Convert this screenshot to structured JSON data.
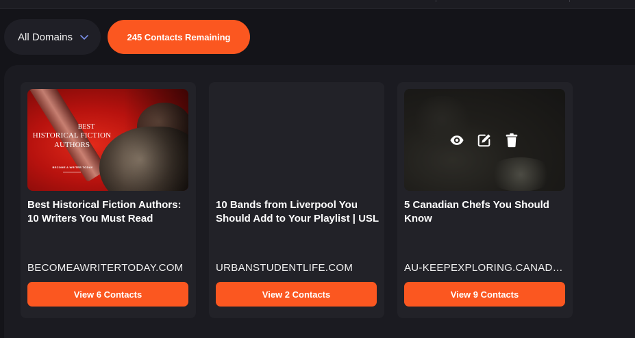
{
  "toolbar": {
    "domain_filter": "All Domains",
    "contacts_remaining": "245 Contacts Remaining"
  },
  "thumbnail_text": {
    "line1": "BEST",
    "line2": "HISTORICAL FICTION",
    "line3": "AUTHORS",
    "line4": "BECOME A WRITER TODAY"
  },
  "cards": [
    {
      "title": "Best Historical Fiction Authors: 10 Writers You Must Read",
      "domain": "BECOMEAWRITERTODAY.COM",
      "button": "View 6 Contacts",
      "thumbnail": "historical-fiction-image"
    },
    {
      "title": "10 Bands from Liverpool You Should Add to Your Playlist | USL",
      "domain": "URBANSTUDENTLIFE.COM",
      "button": "View 2 Contacts",
      "thumbnail": "none"
    },
    {
      "title": "5 Canadian Chefs You Should Know",
      "domain": "AU-KEEPEXPLORING.CANADA.TRAVEL",
      "button": "View 9 Contacts",
      "thumbnail": "food-image",
      "hover_actions": [
        "eye-icon",
        "edit-icon",
        "trash-icon"
      ]
    }
  ],
  "colors": {
    "accent": "#fb5720",
    "background": "#141419",
    "card": "#222228"
  }
}
